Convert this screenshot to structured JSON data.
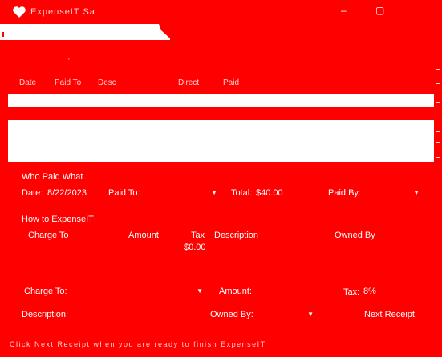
{
  "window": {
    "title": "ExpenseIT Sa",
    "minimize_glyph": "–",
    "maximize_glyph": "▢"
  },
  "tab": {
    "label": ""
  },
  "toolbar_header": {
    "marker": "·",
    "columns": [
      "Date",
      "Paid To",
      "Desc",
      "Direct",
      "Paid"
    ]
  },
  "who_paid_what": {
    "title": "Who Paid What",
    "date_label": "Date:",
    "date_value": "8/22/2023",
    "paid_to_label": "Paid To:",
    "total_label": "Total:",
    "total_value": "$40.00",
    "paid_by_label": "Paid By:"
  },
  "how_to_expense": {
    "title": "How to ExpenseIT",
    "columns": {
      "charge_to": "Charge To",
      "amount": "Amount",
      "tax": "Tax",
      "description": "Description",
      "owned_by": "Owned By"
    },
    "tax_total": "$0.00"
  },
  "form": {
    "charge_to_label": "Charge To:",
    "amount_label": "Amount:",
    "tax_label": "Tax:",
    "tax_value": "8%",
    "description_label": "Description:",
    "owned_by_label": "Owned By:",
    "next_receipt_label": "Next Receipt"
  },
  "status": {
    "text": "Click Next Receipt when you are ready to finish ExpenseIT"
  },
  "icons": {
    "app": "heart-icon",
    "dropdown": "chevron-down-icon"
  },
  "colors": {
    "background": "#ff0000",
    "foreground": "#ffffff"
  }
}
